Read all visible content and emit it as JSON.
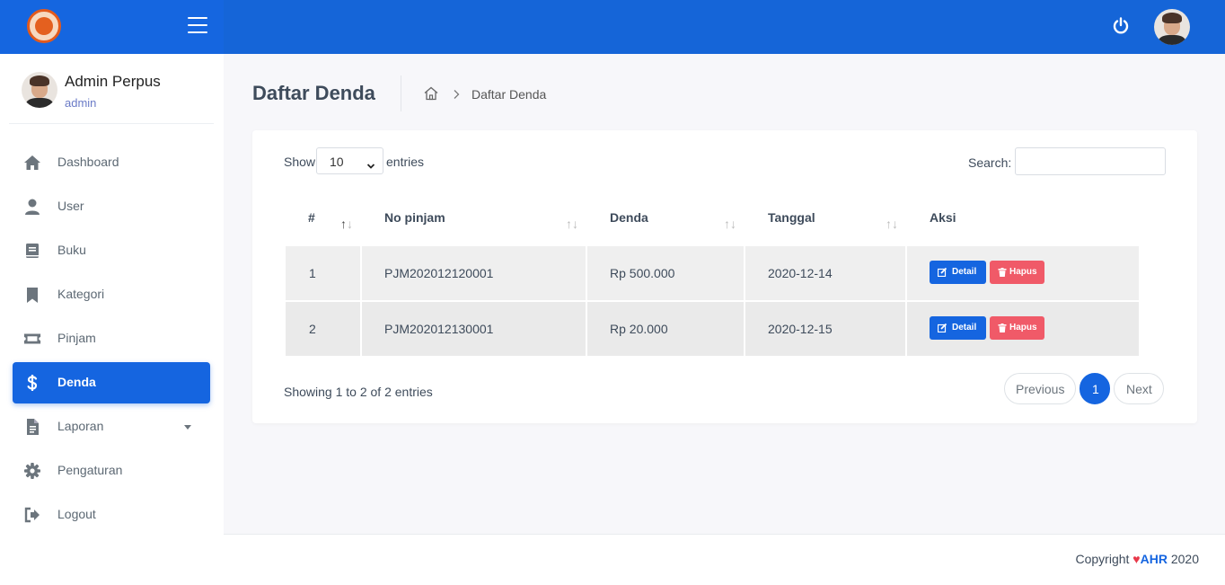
{
  "user": {
    "name": "Admin Perpus",
    "role": "admin"
  },
  "sidebar": {
    "items": [
      {
        "label": "Dashboard",
        "icon": "home-icon"
      },
      {
        "label": "User",
        "icon": "user-icon"
      },
      {
        "label": "Buku",
        "icon": "book-icon"
      },
      {
        "label": "Kategori",
        "icon": "bookmark-icon"
      },
      {
        "label": "Pinjam",
        "icon": "ticket-icon"
      },
      {
        "label": "Denda",
        "icon": "dollar-icon",
        "active": true
      },
      {
        "label": "Laporan",
        "icon": "report-icon",
        "has_submenu": true
      },
      {
        "label": "Pengaturan",
        "icon": "gear-icon"
      },
      {
        "label": "Logout",
        "icon": "logout-icon"
      }
    ]
  },
  "page": {
    "title": "Daftar Denda",
    "breadcrumb": "Daftar Denda"
  },
  "table_controls": {
    "show_label": "Show",
    "page_size": "10",
    "entries_label": "entries",
    "search_label": "Search:",
    "search_value": ""
  },
  "table": {
    "columns": [
      "#",
      "No pinjam",
      "Denda",
      "Tanggal",
      "Aksi"
    ],
    "rows": [
      {
        "no": "1",
        "no_pinjam": "PJM202012120001",
        "denda": "Rp 500.000",
        "tanggal": "2020-12-14",
        "detail_label": "Detail",
        "hapus_label": "Hapus"
      },
      {
        "no": "2",
        "no_pinjam": "PJM202012130001",
        "denda": "Rp 20.000",
        "tanggal": "2020-12-15",
        "detail_label": "Detail",
        "hapus_label": "Hapus"
      }
    ]
  },
  "info": "Showing 1 to 2 of 2 entries",
  "pagination": {
    "previous": "Previous",
    "current": "1",
    "next": "Next"
  },
  "footer": {
    "prefix": "Copyright",
    "brand": "AHR",
    "year": "2020"
  },
  "colors": {
    "primary": "#1565e0",
    "danger": "#f05a68",
    "heart": "#e8394a"
  }
}
